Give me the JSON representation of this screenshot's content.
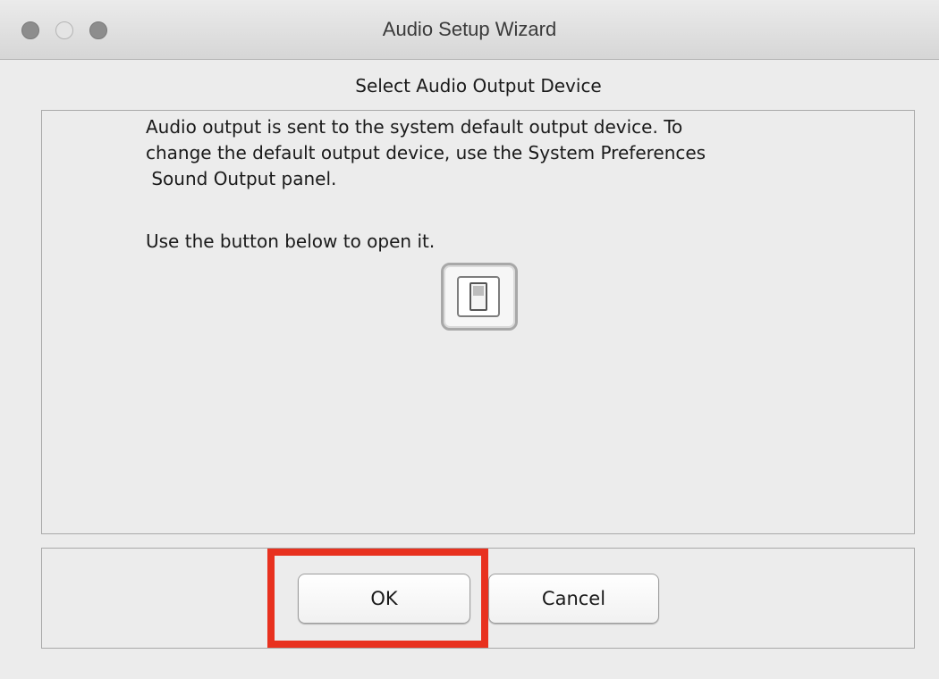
{
  "window": {
    "title": "Audio Setup Wizard",
    "controls": [
      "close",
      "minimize",
      "zoom"
    ]
  },
  "wizard": {
    "step_title": "Select Audio Output Device",
    "paragraph_lines": [
      "Audio output is sent to the system default output device. To",
      "change the default output device, use the System Preferences",
      " Sound Output panel."
    ],
    "instruction": "Use the button below to open it.",
    "open_prefs_button": {
      "icon": "switch-icon"
    }
  },
  "buttons": {
    "ok_label": "OK",
    "cancel_label": "Cancel"
  },
  "annotation": {
    "highlight_target": "ok-button",
    "highlight_color": "#e8311f"
  },
  "colors": {
    "window_bg": "#ececec",
    "border": "#a9a9a9"
  }
}
